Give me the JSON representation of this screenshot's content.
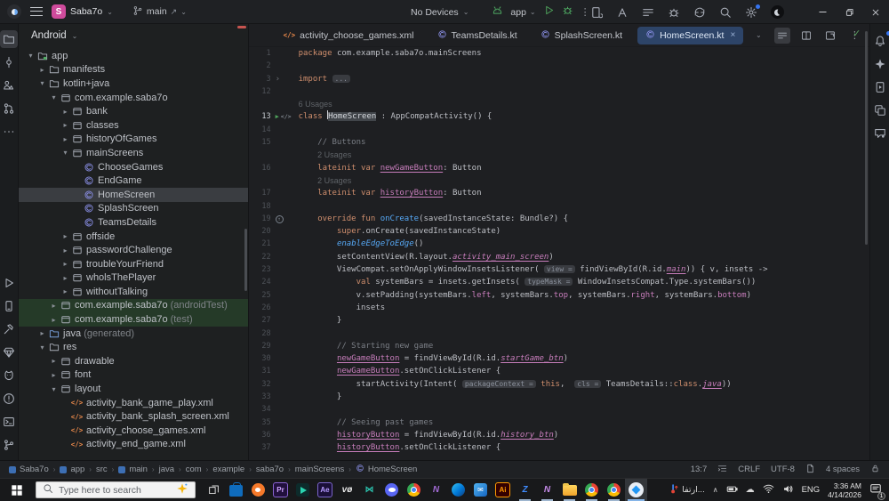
{
  "titlebar": {
    "project_badge": "S",
    "project_name": "Saba7o",
    "branch_name": "main",
    "device_selector": "No Devices",
    "run_config": "app",
    "right_icons": [
      {
        "name": "device-manager-icon"
      },
      {
        "name": "profiler-icon"
      },
      {
        "name": "build-variants-icon"
      },
      {
        "name": "app-inspection-icon"
      },
      {
        "name": "gradle-sync-icon"
      },
      {
        "name": "search-everywhere-icon"
      },
      {
        "name": "settings-icon",
        "badge": true
      },
      {
        "name": "user-avatar"
      }
    ],
    "accent_badge_color": "#cf4b9c"
  },
  "left_strip": {
    "top": [
      {
        "name": "project-tool-icon",
        "active": true
      },
      {
        "name": "commit-tool-icon"
      },
      {
        "name": "structure-tool-icon"
      },
      {
        "name": "pull-requests-tool-icon"
      },
      {
        "name": "more-tools-icon"
      }
    ],
    "bottom": [
      {
        "name": "run-tool-icon"
      },
      {
        "name": "device-manager-tool-icon"
      },
      {
        "name": "build-tool-icon"
      },
      {
        "name": "app-quality-insights-tool-icon"
      },
      {
        "name": "logcat-tool-icon"
      },
      {
        "name": "problems-tool-icon"
      },
      {
        "name": "terminal-tool-icon"
      },
      {
        "name": "version-control-tool-icon"
      }
    ]
  },
  "right_strip": [
    {
      "name": "notifications-icon",
      "badge": true
    },
    {
      "name": "gemini-icon"
    },
    {
      "name": "running-devices-icon"
    },
    {
      "name": "layout-inspector-icon"
    },
    {
      "name": "ai-chat-icon"
    }
  ],
  "project_panel": {
    "header": "Android",
    "tree": [
      {
        "label": "app",
        "depth": 0,
        "icon": "module",
        "chev": "open"
      },
      {
        "label": "manifests",
        "depth": 1,
        "icon": "folder",
        "chev": "closed"
      },
      {
        "label": "kotlin+java",
        "depth": 1,
        "icon": "folder",
        "chev": "open"
      },
      {
        "label": "com.example.saba7o",
        "depth": 2,
        "icon": "pkg",
        "chev": "open"
      },
      {
        "label": "bank",
        "depth": 3,
        "icon": "pkg",
        "chev": "closed"
      },
      {
        "label": "classes",
        "depth": 3,
        "icon": "pkg",
        "chev": "closed"
      },
      {
        "label": "historyOfGames",
        "depth": 3,
        "icon": "pkg",
        "chev": "closed"
      },
      {
        "label": "mainScreens",
        "depth": 3,
        "icon": "pkg",
        "chev": "open"
      },
      {
        "label": "ChooseGames",
        "depth": 4,
        "icon": "kclass"
      },
      {
        "label": "EndGame",
        "depth": 4,
        "icon": "kclass"
      },
      {
        "label": "HomeScreen",
        "depth": 4,
        "icon": "kclass",
        "selected": true
      },
      {
        "label": "SplashScreen",
        "depth": 4,
        "icon": "kclass"
      },
      {
        "label": "TeamsDetails",
        "depth": 4,
        "icon": "kclass"
      },
      {
        "label": "offside",
        "depth": 3,
        "icon": "pkg",
        "chev": "closed"
      },
      {
        "label": "passwordChallenge",
        "depth": 3,
        "icon": "pkg",
        "chev": "closed"
      },
      {
        "label": "troubleYourFriend",
        "depth": 3,
        "icon": "pkg",
        "chev": "closed"
      },
      {
        "label": "wholsThePlayer",
        "depth": 3,
        "icon": "pkg",
        "chev": "closed"
      },
      {
        "label": "withoutTalking",
        "depth": 3,
        "icon": "pkg",
        "chev": "closed"
      },
      {
        "label": "com.example.saba7o",
        "suffix": "(androidTest)",
        "depth": 2,
        "icon": "pkg",
        "chev": "closed",
        "green": true
      },
      {
        "label": "com.example.saba7o",
        "suffix": "(test)",
        "depth": 2,
        "icon": "pkg",
        "chev": "closed",
        "green": true
      },
      {
        "label": "java",
        "suffix": "(generated)",
        "depth": 1,
        "icon": "folderb",
        "chev": "closed"
      },
      {
        "label": "res",
        "depth": 1,
        "icon": "folder",
        "chev": "open"
      },
      {
        "label": "drawable",
        "depth": 2,
        "icon": "pkg",
        "chev": "closed"
      },
      {
        "label": "font",
        "depth": 2,
        "icon": "pkg",
        "chev": "closed"
      },
      {
        "label": "layout",
        "depth": 2,
        "icon": "pkg",
        "chev": "open"
      },
      {
        "label": "activity_bank_game_play.xml",
        "depth": 3,
        "icon": "xml"
      },
      {
        "label": "activity_bank_splash_screen.xml",
        "depth": 3,
        "icon": "xml"
      },
      {
        "label": "activity_choose_games.xml",
        "depth": 3,
        "icon": "xml"
      },
      {
        "label": "activity_end_game.xml",
        "depth": 3,
        "icon": "xml"
      }
    ]
  },
  "editor": {
    "tabs": [
      {
        "label": "activity_choose_games.xml",
        "icon": "xml"
      },
      {
        "label": "TeamsDetails.kt",
        "icon": "kclass"
      },
      {
        "label": "SplashScreen.kt",
        "icon": "kclass"
      },
      {
        "label": "HomeScreen.kt",
        "icon": "kclass",
        "active": true,
        "close": "×"
      }
    ],
    "tab_actions": [
      {
        "name": "tab-list-chevron-icon"
      },
      {
        "name": "editor-list-icon",
        "active": true
      },
      {
        "name": "split-editor-icon"
      },
      {
        "name": "detach-editor-icon"
      },
      {
        "name": "editor-more-icon"
      }
    ],
    "inspection_ok": "✓",
    "lines": [
      {
        "n": "1",
        "seg": [
          [
            "k",
            "package "
          ],
          [
            "t",
            "com.example.saba7o.mainScreens"
          ]
        ]
      },
      {
        "n": "2",
        "seg": []
      },
      {
        "n": "3",
        "fold": true,
        "seg": [
          [
            "k",
            "import "
          ],
          [
            "chip",
            "..."
          ]
        ]
      },
      {
        "n": "12",
        "seg": []
      },
      {
        "usage": "6 Usages",
        "indent": 0
      },
      {
        "n": "13",
        "current": true,
        "gutter": "run",
        "seg": [
          [
            "k",
            "class "
          ],
          [
            "caret",
            ""
          ],
          [
            "sel",
            "HomeScreen"
          ],
          [
            "t",
            " : AppCompatActivity() {"
          ]
        ]
      },
      {
        "n": "14",
        "seg": []
      },
      {
        "n": "15",
        "seg": [
          [
            "cm",
            "    // Buttons"
          ]
        ]
      },
      {
        "usage": "2 Usages",
        "indent": 4
      },
      {
        "n": "16",
        "seg": [
          [
            "k",
            "    lateinit var "
          ],
          [
            "prop",
            "newGameButton"
          ],
          [
            "t",
            ": Button"
          ]
        ]
      },
      {
        "usage": "2 Usages",
        "indent": 4
      },
      {
        "n": "17",
        "seg": [
          [
            "k",
            "    lateinit var "
          ],
          [
            "prop",
            "historyButton"
          ],
          [
            "t",
            ": Button"
          ]
        ]
      },
      {
        "n": "18",
        "seg": []
      },
      {
        "n": "19",
        "gutter": "override",
        "seg": [
          [
            "k",
            "    override fun "
          ],
          [
            "fn",
            "onCreate"
          ],
          [
            "t",
            "(savedInstanceState: Bundle?) {"
          ]
        ]
      },
      {
        "n": "20",
        "seg": [
          [
            "t",
            "        "
          ],
          [
            "k",
            "super"
          ],
          [
            "t",
            ".onCreate(savedInstanceState)"
          ]
        ]
      },
      {
        "n": "21",
        "seg": [
          [
            "t",
            "        "
          ],
          [
            "ifn",
            "enableEdgeToEdge"
          ],
          [
            "t",
            "()"
          ]
        ]
      },
      {
        "n": "22",
        "seg": [
          [
            "t",
            "        setContentView(R.layout."
          ],
          [
            "st",
            "activity_main_screen"
          ],
          [
            "t",
            ")"
          ]
        ]
      },
      {
        "n": "23",
        "seg": [
          [
            "t",
            "        ViewCompat.setOnApplyWindowInsetsListener( "
          ],
          [
            "chip",
            "view ="
          ],
          [
            "t",
            " findViewById(R.id."
          ],
          [
            "st",
            "main"
          ],
          [
            "t",
            ")) { v, insets ->"
          ]
        ]
      },
      {
        "n": "24",
        "seg": [
          [
            "t",
            "            "
          ],
          [
            "k",
            "val"
          ],
          [
            "t",
            " systemBars = insets.getInsets( "
          ],
          [
            "chip",
            "typeMask ="
          ],
          [
            "t",
            " WindowInsetsCompat.Type.systemBars())"
          ]
        ]
      },
      {
        "n": "25",
        "seg": [
          [
            "t",
            "            v.setPadding(systemBars."
          ],
          [
            "p",
            "left"
          ],
          [
            "t",
            ", systemBars."
          ],
          [
            "p",
            "top"
          ],
          [
            "t",
            ", systemBars."
          ],
          [
            "p",
            "right"
          ],
          [
            "t",
            ", systemBars."
          ],
          [
            "p",
            "bottom"
          ],
          [
            "t",
            ")"
          ]
        ]
      },
      {
        "n": "26",
        "seg": [
          [
            "t",
            "            insets"
          ]
        ]
      },
      {
        "n": "27",
        "seg": [
          [
            "t",
            "        }"
          ]
        ]
      },
      {
        "n": "28",
        "seg": []
      },
      {
        "n": "29",
        "seg": [
          [
            "cm",
            "        // Starting new game"
          ]
        ]
      },
      {
        "n": "30",
        "seg": [
          [
            "t",
            "        "
          ],
          [
            "prop",
            "newGameButton"
          ],
          [
            "t",
            " = findViewById(R.id."
          ],
          [
            "st",
            "startGame_btn"
          ],
          [
            "t",
            ")"
          ]
        ]
      },
      {
        "n": "31",
        "seg": [
          [
            "t",
            "        "
          ],
          [
            "prop",
            "newGameButton"
          ],
          [
            "t",
            ".setOnClickListener {"
          ]
        ]
      },
      {
        "n": "32",
        "seg": [
          [
            "t",
            "            startActivity(Intent( "
          ],
          [
            "chip",
            "packageContext ="
          ],
          [
            "t",
            " "
          ],
          [
            "k",
            "this"
          ],
          [
            "t",
            ",  "
          ],
          [
            "chip",
            "cls ="
          ],
          [
            "t",
            " TeamsDetails::"
          ],
          [
            "k",
            "class"
          ],
          [
            "t",
            "."
          ],
          [
            "st",
            "java"
          ],
          [
            "t",
            "))"
          ]
        ]
      },
      {
        "n": "33",
        "seg": [
          [
            "t",
            "        }"
          ]
        ]
      },
      {
        "n": "34",
        "seg": []
      },
      {
        "n": "35",
        "seg": [
          [
            "cm",
            "        // Seeing past games"
          ]
        ]
      },
      {
        "n": "36",
        "seg": [
          [
            "t",
            "        "
          ],
          [
            "prop",
            "historyButton"
          ],
          [
            "t",
            " = findViewById(R.id."
          ],
          [
            "st",
            "history_btn"
          ],
          [
            "t",
            ")"
          ]
        ]
      },
      {
        "n": "37",
        "seg": [
          [
            "t",
            "        "
          ],
          [
            "prop",
            "historyButton"
          ],
          [
            "t",
            ".setOnClickListener {"
          ]
        ]
      }
    ]
  },
  "statusbar": {
    "crumbs": [
      {
        "label": "Saba7o",
        "icon": "module"
      },
      {
        "label": "app",
        "icon": "module"
      },
      {
        "label": "src"
      },
      {
        "label": "main",
        "icon": "module"
      },
      {
        "label": "java"
      },
      {
        "label": "com"
      },
      {
        "label": "example"
      },
      {
        "label": "saba7o"
      },
      {
        "label": "mainScreens"
      },
      {
        "label": "HomeScreen",
        "icon": "kclass"
      }
    ],
    "caret_position": "13:7",
    "line_separator": "CRLF",
    "encoding": "UTF-8",
    "indent": "4 spaces"
  },
  "taskbar": {
    "search_placeholder": "Type here to search",
    "apps": [
      {
        "name": "task-view-button",
        "kind": "taskview"
      },
      {
        "name": "microsoft-store",
        "kind": "store"
      },
      {
        "name": "blender",
        "kind": "blender"
      },
      {
        "name": "premiere-pro",
        "kind": "badge",
        "text": "Pr",
        "bg": "#21103d",
        "fg": "#cfa6ff",
        "bd": "#8a63d2"
      },
      {
        "name": "video-editor",
        "kind": "play"
      },
      {
        "name": "after-effects",
        "kind": "badge",
        "text": "Ae",
        "bg": "#1a0f38",
        "fg": "#b49aff",
        "bd": "#7c66cc"
      },
      {
        "name": "vo-app",
        "kind": "text",
        "text": "vø",
        "fg": "#e6e6e6"
      },
      {
        "name": "butterfly-app",
        "kind": "text",
        "text": "⋈",
        "fg": "#2cc9b4"
      },
      {
        "name": "discord",
        "kind": "discord"
      },
      {
        "name": "chrome",
        "kind": "chrome"
      },
      {
        "name": "visual-studio",
        "kind": "text",
        "text": "N",
        "fg": "#a36bd6"
      },
      {
        "name": "microsoft-edge",
        "kind": "edge"
      },
      {
        "name": "outlook-mail",
        "kind": "mail",
        "text": "✉"
      },
      {
        "name": "illustrator",
        "kind": "badge",
        "text": "Ai",
        "bg": "#330000",
        "fg": "#ff9a00",
        "bd": "#ff9a00"
      },
      {
        "name": "app-z",
        "kind": "text",
        "text": "Z",
        "fg": "#3f8cff",
        "open": true
      },
      {
        "name": "visual-studio-preview",
        "kind": "text",
        "text": "N",
        "fg": "#c48ae8",
        "open": true
      },
      {
        "name": "file-explorer",
        "kind": "explorer",
        "open": true
      },
      {
        "name": "chrome-profile-1",
        "kind": "chrome",
        "open": true
      },
      {
        "name": "chrome-profile-2",
        "kind": "chrome",
        "open": true
      },
      {
        "name": "android-studio",
        "kind": "astudio",
        "active": true
      }
    ],
    "tray": {
      "temp_label": "ارتفا...",
      "language": "ENG",
      "time": "3:36 AM",
      "date": "4/14/2026",
      "notification_count": "1"
    }
  }
}
